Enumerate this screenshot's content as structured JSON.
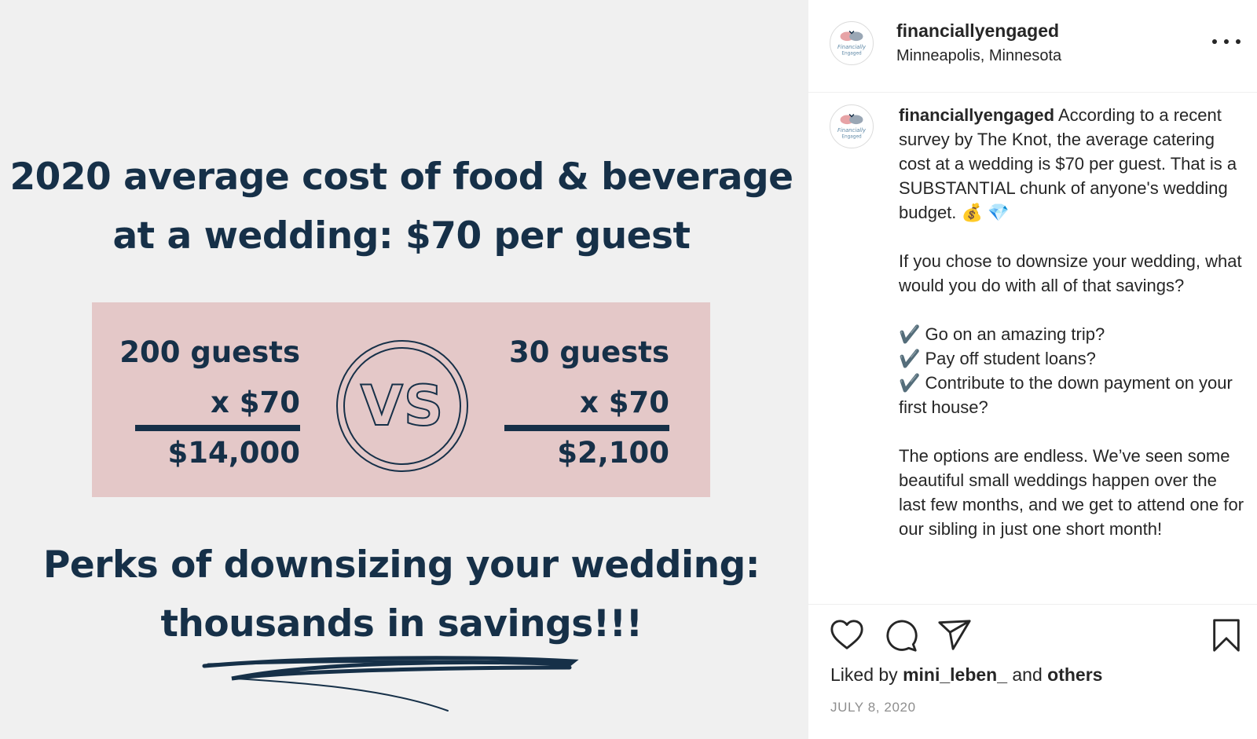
{
  "post_image": {
    "headline_line1": "2020 average cost of food & beverage",
    "headline_line2": "at a wedding: $70 per guest",
    "left_calc": {
      "guests": "200 guests",
      "multiplier": "x $70",
      "total": "$14,000"
    },
    "vs_label": "VS",
    "right_calc": {
      "guests": "30 guests",
      "multiplier": "x $70",
      "total": "$2,100"
    },
    "perks_line1": "Perks of downsizing your wedding:",
    "perks_line2": "thousands in savings!!!",
    "colors": {
      "navy": "#163048",
      "pink": "#e4c8c8",
      "background": "#f0f0f0"
    }
  },
  "header": {
    "username": "financiallyengaged",
    "location": "Minneapolis, Minnesota",
    "avatar_logo_text": "Financially Engaged",
    "more_icon": "more-options-icon"
  },
  "caption": {
    "username": "financiallyengaged",
    "para1": " According to a recent survey by The Knot, the average catering cost at a wedding is $70 per guest. That is a SUBSTANTIAL chunk of anyone's wedding budget. 💰 💎",
    "para2": "If you chose to downsize your wedding, what would you do with all of that savings?",
    "check1": "✔️ Go on an amazing trip?",
    "check2": "✔️ Pay off student loans?",
    "check3": "✔️ Contribute to the down payment on your first house?",
    "para3": "The options are endless. We’ve seen some beautiful small weddings happen over the last few months, and we get to attend one for our sibling in just one short month!"
  },
  "actions": {
    "icons": [
      "heart-icon",
      "comment-icon",
      "share-icon",
      "bookmark-icon"
    ],
    "liked_by_prefix": "Liked by ",
    "liked_by_user": "mini_leben_",
    "liked_by_and": " and ",
    "liked_by_others": "others",
    "date": "JULY 8, 2020"
  }
}
